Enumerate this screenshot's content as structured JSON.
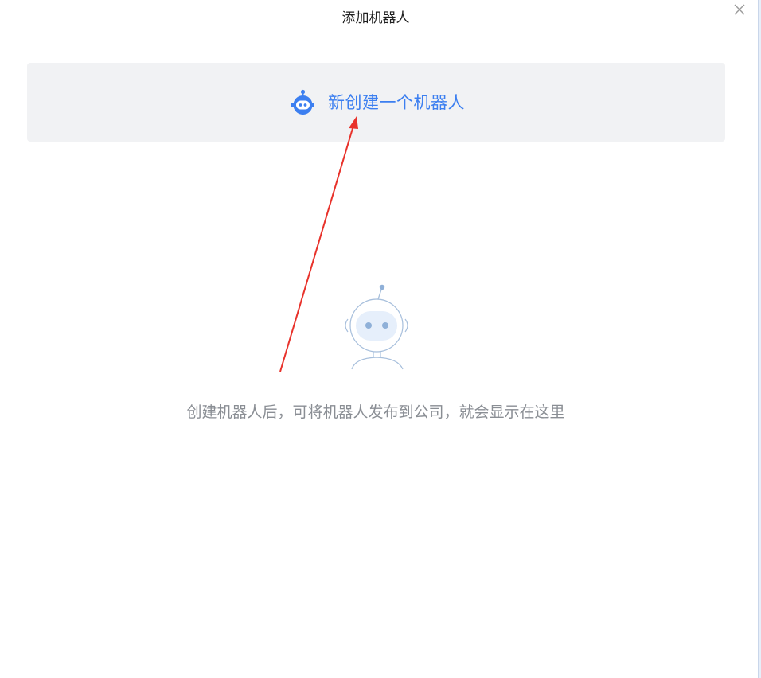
{
  "dialog": {
    "title": "添加机器人",
    "close_icon": "close-icon"
  },
  "create_card": {
    "icon": "robot-icon",
    "label": "新创建一个机器人",
    "accent_color": "#3c7ff0"
  },
  "empty_state": {
    "illustration": "robot-illustration",
    "message": "创建机器人后，可将机器人发布到公司，就会显示在这里"
  },
  "annotation": {
    "type": "arrow",
    "color": "#e8322b"
  }
}
